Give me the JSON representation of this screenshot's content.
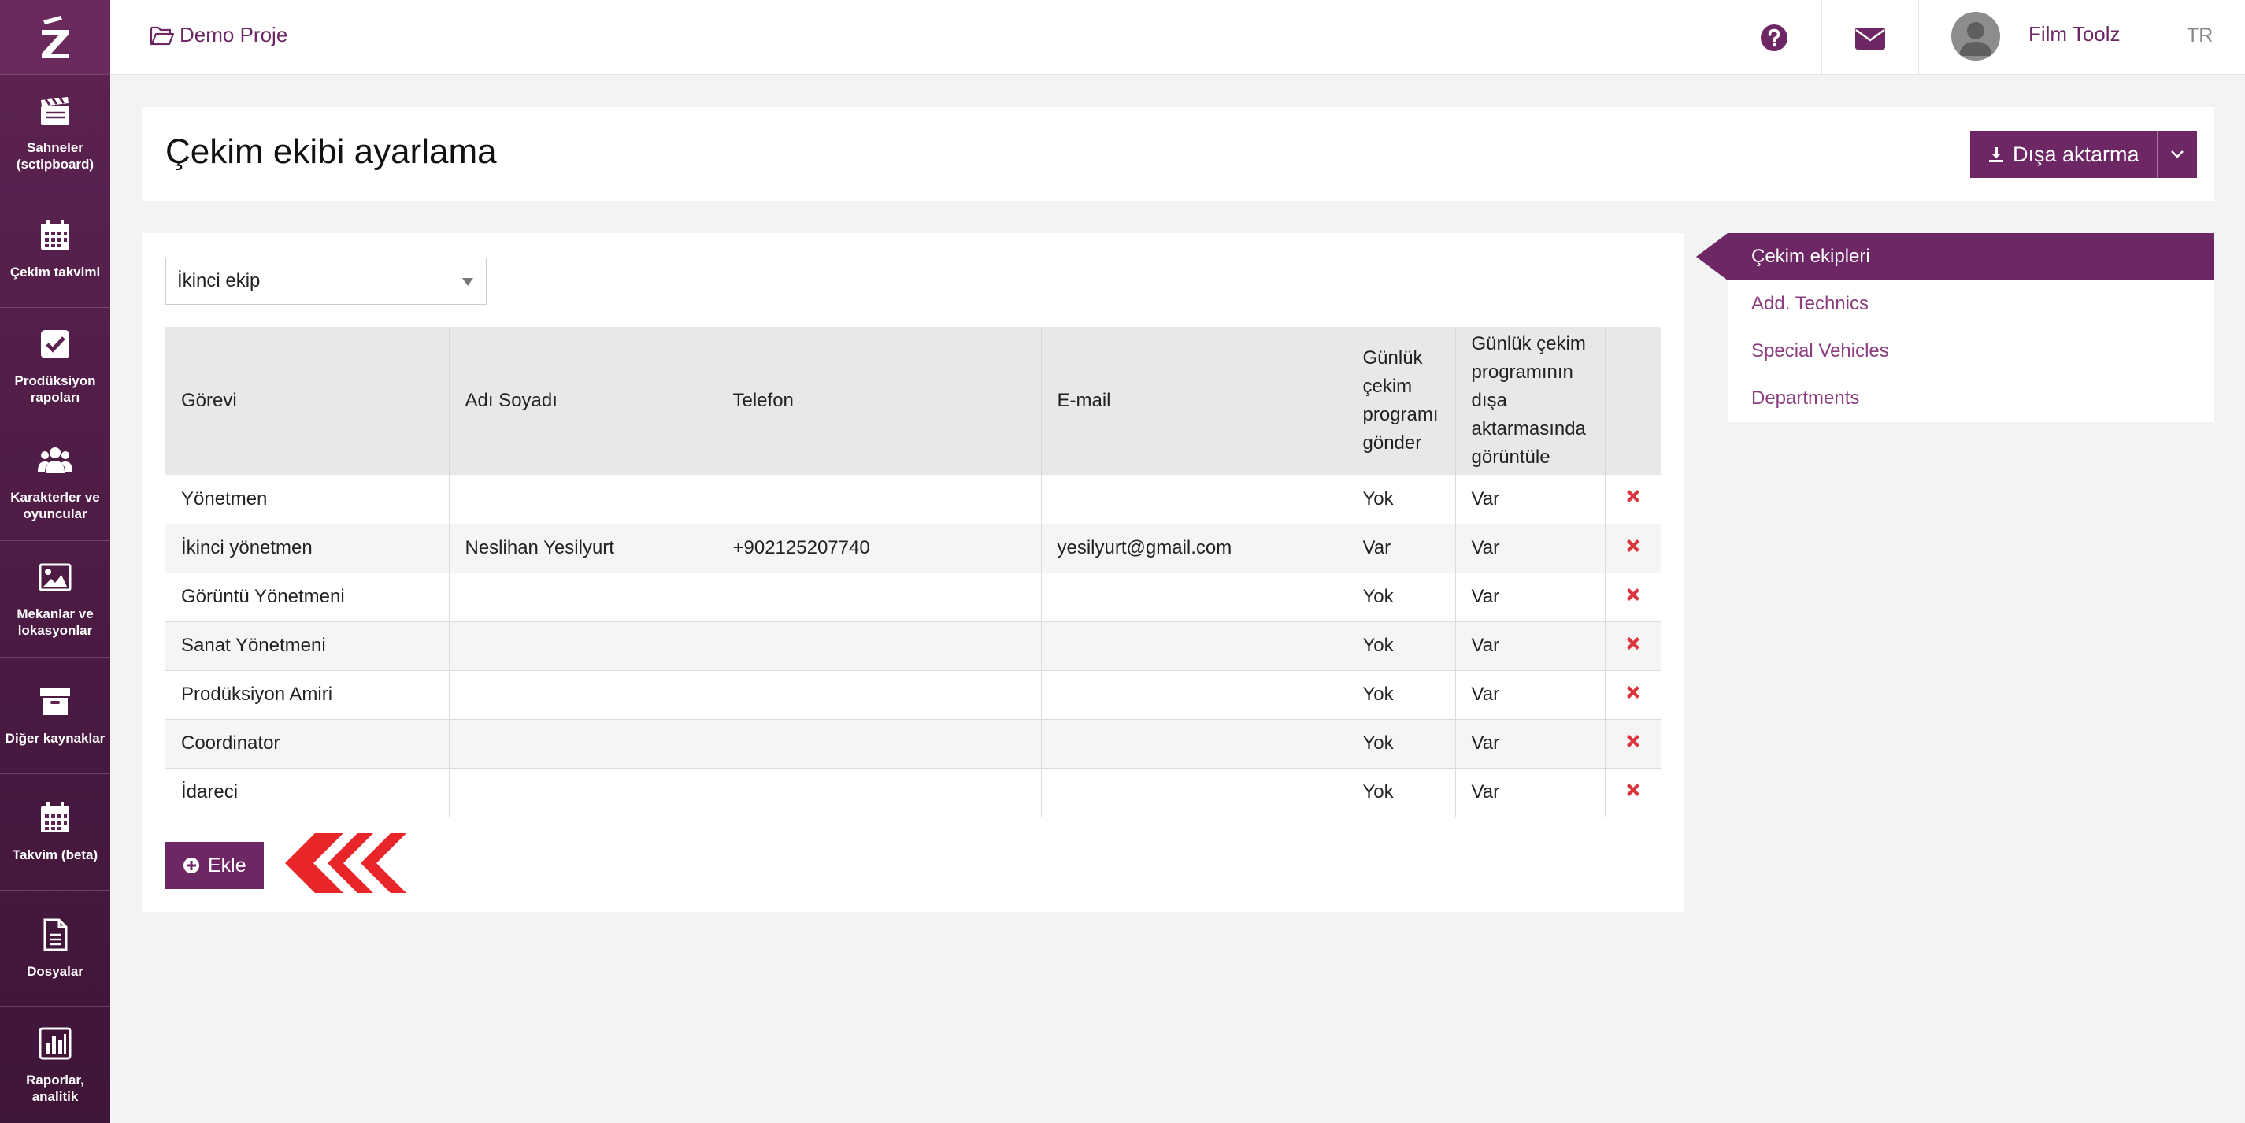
{
  "sidebar": {
    "items": [
      {
        "label": "Sahneler (sctipboard)",
        "icon": "clapperboard-icon"
      },
      {
        "label": "Çekim takvimi",
        "icon": "calendar-icon"
      },
      {
        "label": "Prodüksiyon rapoları",
        "icon": "checkbox-icon"
      },
      {
        "label": "Karakterler ve oyuncular",
        "icon": "users-icon"
      },
      {
        "label": "Mekanlar ve lokasyonlar",
        "icon": "image-icon"
      },
      {
        "label": "Diğer kaynaklar",
        "icon": "archive-icon"
      },
      {
        "label": "Takvim (beta)",
        "icon": "calendar-icon"
      },
      {
        "label": "Dosyalar",
        "icon": "file-icon"
      },
      {
        "label": "Raporlar, analitik",
        "icon": "bar-chart-icon"
      }
    ]
  },
  "topbar": {
    "project": "Demo Proje",
    "user_name": "Film Toolz",
    "language": "TR"
  },
  "header": {
    "title": "Çekim ekibi ayarlama",
    "export_label": "Dışa aktarma"
  },
  "crew_select": {
    "value": "İkinci ekip"
  },
  "table": {
    "headers": [
      "Görevi",
      "Adı Soyadı",
      "Telefon",
      "E-mail",
      "Günlük çekim programı gönder",
      "Günlük çekim programının dışa aktarmasında görüntüle",
      ""
    ],
    "rows": [
      [
        "Yönetmen",
        "",
        "",
        "",
        "Yok",
        "Var"
      ],
      [
        "İkinci yönetmen",
        "Neslihan Yesilyurt",
        "+902125207740",
        "yesilyurt@gmail.com",
        "Var",
        "Var"
      ],
      [
        "Görüntü Yönetmeni",
        "",
        "",
        "",
        "Yok",
        "Var"
      ],
      [
        "Sanat Yönetmeni",
        "",
        "",
        "",
        "Yok",
        "Var"
      ],
      [
        "Prodüksiyon Amiri",
        "",
        "",
        "",
        "Yok",
        "Var"
      ],
      [
        "Coordinator",
        "",
        "",
        "",
        "Yok",
        "Var"
      ],
      [
        "İdareci",
        "",
        "",
        "",
        "Yok",
        "Var"
      ]
    ]
  },
  "add_label": "Ekle",
  "side_menu": {
    "items": [
      "Çekim ekipleri",
      "Add. Technics",
      "Special Vehicles",
      "Departments"
    ],
    "active_index": 0
  },
  "colors": {
    "brand": "#6d2765",
    "delete": "#d9363e",
    "arrow": "#e8262a"
  }
}
